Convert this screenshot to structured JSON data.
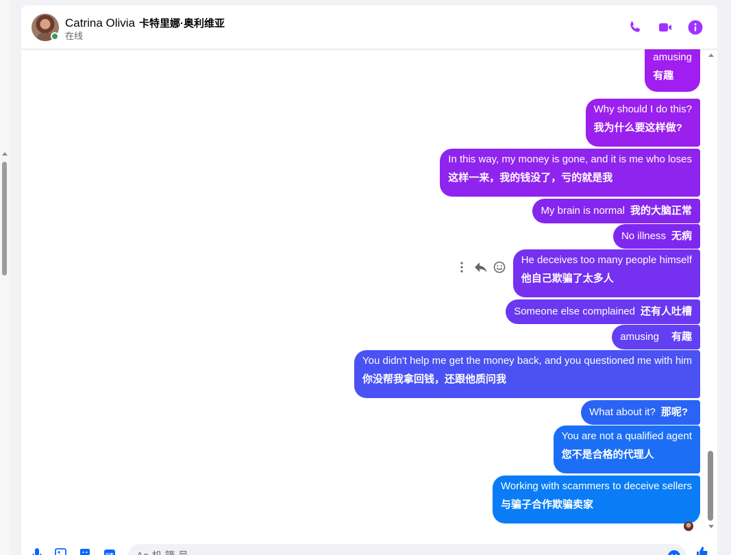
{
  "contact": {
    "name": "Catrina Olivia",
    "name_cn": "卡特里娜·奥利维亚",
    "status": "在线"
  },
  "header_icons": [
    "phone-icon",
    "video-camera-icon",
    "info-icon"
  ],
  "accent_color": "#a033ff",
  "messages": [
    {
      "en": "amusing",
      "cn": "有趣",
      "color": "#a11ef0"
    },
    {
      "en": "Why should I do this?",
      "cn": "我为什么要这样做?",
      "color": "#9a20ee"
    },
    {
      "en": "In this way, my money is gone, and it is me who loses",
      "cn": "这样一来，我的钱没了，亏的就是我",
      "color": "#8f24ee"
    },
    {
      "en": "My brain is normal",
      "cn": "我的大脑正常",
      "color": "#8526ee"
    },
    {
      "en": "No illness",
      "cn": "无病",
      "color": "#7e28ef"
    },
    {
      "en": "He deceives too many people himself",
      "cn": "他自己欺骗了太多人",
      "color": "#7630f0"
    },
    {
      "en": "Someone else complained",
      "cn": "还有人吐槽",
      "color": "#6a38f1"
    },
    {
      "en": "amusing",
      "cn": "有趣",
      "color": "#6240f2"
    },
    {
      "en": "You didn't help me get the money back, and you questioned me with him",
      "cn": "你没帮我拿回钱，还跟他质问我",
      "color": "#4a52f3"
    },
    {
      "en": "What about it?",
      "cn": "那呢?",
      "color": "#2a64f4"
    },
    {
      "en": "You are not a qualified agent",
      "cn": "您不是合格的代理人",
      "color": "#1c6ff5"
    },
    {
      "en": "Working with scammers to deceive sellers",
      "cn": "与骗子合作欺骗卖家",
      "color": "#0a7cf6"
    }
  ],
  "composer": {
    "placeholder": "Aa 机 箴 号"
  }
}
